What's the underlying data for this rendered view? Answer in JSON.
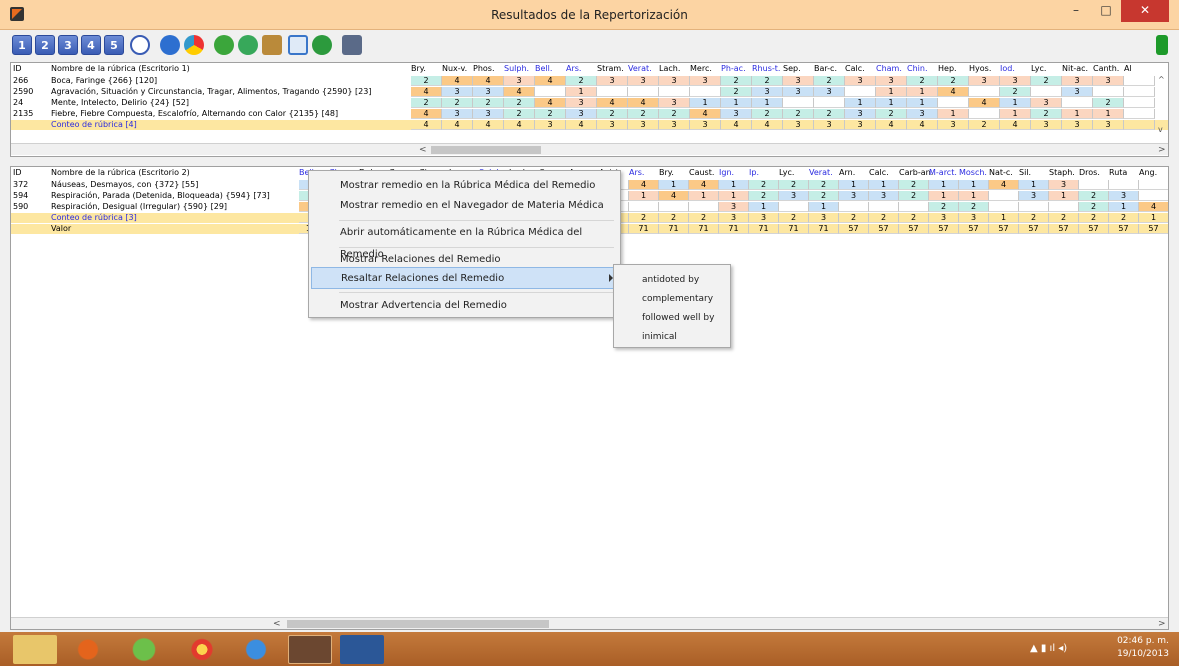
{
  "window": {
    "title": "Resultados de la Repertorización",
    "min": "–",
    "max": "□",
    "close": "✕"
  },
  "toolbar": {
    "numbers": [
      "1",
      "2",
      "3",
      "4",
      "5"
    ]
  },
  "panel1": {
    "header_id": "ID",
    "header_name": "Nombre de la rúbrica (Escritorio 1)",
    "remedies": [
      "Bry.",
      "Nux-v.",
      "Phos.",
      "Sulph.",
      "Bell.",
      "Ars.",
      "Stram.",
      "Verat.",
      "Lach.",
      "Merc.",
      "Ph-ac.",
      "Rhus-t.",
      "Sep.",
      "Bar-c.",
      "Calc.",
      "Cham.",
      "Chin.",
      "Hep.",
      "Hyos.",
      "Iod.",
      "Lyc.",
      "Nit-ac.",
      "Canth.",
      "Al"
    ],
    "rows": [
      {
        "id": "266",
        "name": "Boca, Faringe {266} [120]",
        "vals": [
          "2",
          "4",
          "4",
          "3",
          "4",
          "2",
          "3",
          "3",
          "3",
          "3",
          "2",
          "2",
          "3",
          "2",
          "3",
          "3",
          "2",
          "2",
          "3",
          "3",
          "2",
          "3",
          "3",
          ""
        ]
      },
      {
        "id": "2590",
        "name": "Agravación, Situación y Circunstancia, Tragar, Alimentos, Tragando {2590} [23]",
        "vals": [
          "4",
          "3",
          "3",
          "4",
          "",
          "1",
          "",
          "",
          "",
          "",
          "2",
          "3",
          "3",
          "3",
          "",
          "1",
          "1",
          "4",
          "",
          "2",
          "",
          "3",
          "",
          ""
        ]
      },
      {
        "id": "24",
        "name": "Mente, Intelecto, Delirio {24} [52]",
        "vals": [
          "2",
          "2",
          "2",
          "2",
          "4",
          "3",
          "4",
          "4",
          "3",
          "1",
          "1",
          "1",
          "",
          "",
          "1",
          "1",
          "1",
          "",
          "4",
          "1",
          "3",
          "",
          "2",
          ""
        ]
      },
      {
        "id": "2135",
        "name": "Fiebre, Fiebre Compuesta, Escalofrío, Alternando con Calor {2135} [48]",
        "vals": [
          "4",
          "3",
          "3",
          "2",
          "2",
          "3",
          "2",
          "2",
          "2",
          "4",
          "3",
          "2",
          "2",
          "2",
          "3",
          "2",
          "3",
          "1",
          "",
          "1",
          "2",
          "1",
          "1",
          ""
        ]
      },
      {
        "id": "",
        "name": "Conteo de rúbrica [4]",
        "vals": [
          "4",
          "4",
          "4",
          "4",
          "3",
          "4",
          "3",
          "3",
          "3",
          "3",
          "4",
          "4",
          "3",
          "3",
          "3",
          "4",
          "4",
          "3",
          "2",
          "4",
          "3",
          "3",
          "3",
          ""
        ]
      }
    ]
  },
  "panel2": {
    "header_id": "ID",
    "header_name": "Nombre de la rúbrica (Escritorio 2)",
    "remedies": [
      "Bell.",
      "Cham.",
      "Dulc.",
      "Cupr.",
      "Cina",
      "Laur.",
      "Sulph.",
      "Lach.",
      "Op.",
      "Acon.",
      "Ant-t.",
      "Ars.",
      "Bry.",
      "Caust.",
      "Ign.",
      "Ip.",
      "Lyc.",
      "Verat.",
      "Arn.",
      "Calc.",
      "Carb-an.",
      "M-arct.",
      "Mosch.",
      "Nat-c.",
      "Sil.",
      "Staph.",
      "Dros.",
      "Ruta",
      "Ang."
    ],
    "rows": [
      {
        "id": "372",
        "name": "Náuseas, Desmayos, con {372} [55]",
        "vals": [
          "1",
          "",
          "",
          "",
          "",
          "",
          "",
          "",
          "",
          "",
          "",
          "4",
          "1",
          "4",
          "1",
          "2",
          "2",
          "2",
          "1",
          "1",
          "2",
          "1",
          "1",
          "4",
          "1",
          "3",
          "",
          "",
          ""
        ]
      },
      {
        "id": "594",
        "name": "Respiración, Parada (Detenida, Bloqueada) {594} [73]",
        "vals": [
          "2",
          "",
          "",
          "",
          "",
          "",
          "",
          "",
          "",
          "",
          "",
          "1",
          "4",
          "1",
          "1",
          "2",
          "3",
          "2",
          "3",
          "3",
          "2",
          "1",
          "1",
          "",
          "3",
          "1",
          "2",
          "3",
          ""
        ]
      },
      {
        "id": "590",
        "name": "Respiración, Desigual (Irregular) {590} [29]",
        "vals": [
          "4",
          "",
          "",
          "",
          "",
          "",
          "",
          "",
          "",
          "",
          "",
          "",
          "",
          "",
          "3",
          "1",
          "",
          "1",
          "",
          "",
          "",
          "2",
          "2",
          "",
          "",
          "",
          "2",
          "1",
          "4"
        ]
      },
      {
        "id": "",
        "name": "Conteo de rúbrica [3]",
        "vals": [
          "3",
          "",
          "",
          "",
          "",
          "",
          "",
          "",
          "",
          "",
          "",
          "2",
          "2",
          "2",
          "3",
          "3",
          "2",
          "3",
          "2",
          "2",
          "2",
          "3",
          "3",
          "1",
          "2",
          "2",
          "2",
          "2",
          "1"
        ]
      },
      {
        "id": "",
        "name": "Valor",
        "vals": [
          "100",
          "",
          "",
          "",
          "",
          "",
          "",
          "",
          "",
          "",
          "",
          "71",
          "71",
          "71",
          "71",
          "71",
          "71",
          "71",
          "57",
          "57",
          "57",
          "57",
          "57",
          "57",
          "57",
          "57",
          "57",
          "57",
          "57"
        ]
      }
    ]
  },
  "context_menu": {
    "items": [
      "Mostrar remedio en la Rúbrica Médica del Remedio",
      "Mostrar remedio en el Navegador de Materia Médica",
      "Abrir automáticamente en la Rúbrica Médica del Remedio",
      "Mostrar Relaciones del Remedio",
      "Resaltar Relaciones del Remedio",
      "Mostrar Advertencia del Remedio"
    ],
    "submenu": [
      "antidoted by",
      "complementary",
      "followed well by",
      "inimical"
    ]
  },
  "taskbar": {
    "time": "02:46 p. m.",
    "date": "19/10/2013"
  },
  "colors": {
    "title_bg": "#fcd4a3",
    "close_red": "#c7372f",
    "cell_orange": "#fbc987",
    "cell_blue": "#c9e1f6",
    "cell_peach": "#fbd6c0",
    "cell_mint": "#c5eee6",
    "count_yellow": "#fde7a1",
    "menu_highlight": "#cfe2f7",
    "taskbar": "#b86c30"
  }
}
